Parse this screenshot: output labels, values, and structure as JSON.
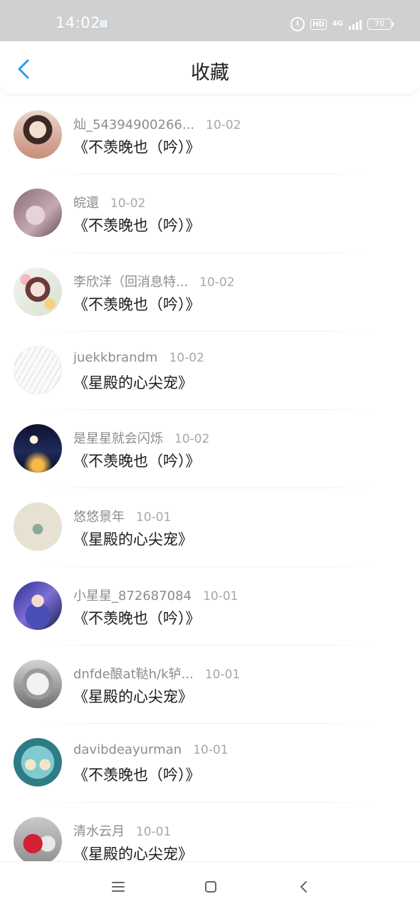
{
  "status_bar": {
    "time": "14:02",
    "hd_label": "HD",
    "network": "4G",
    "battery": "70"
  },
  "header": {
    "title": "收藏",
    "back_icon": "chevron-left-icon",
    "accent_color": "#2b9be8"
  },
  "favorites": [
    {
      "nickname": "灿_54394900266...",
      "date": "10-02",
      "work": "《不羡晚也（吟）》",
      "avatar": "avatar-girl-portrait"
    },
    {
      "nickname": "皖還",
      "date": "10-02",
      "work": "《不羡晚也（吟）》",
      "avatar": "avatar-anime-mauve"
    },
    {
      "nickname": "李欣洋（回消息特...",
      "date": "10-02",
      "work": "《不羡晚也（吟）》",
      "avatar": "avatar-anime-flowers"
    },
    {
      "nickname": "juekkbrandm",
      "date": "10-02",
      "work": "《星殿的心尖宠》",
      "avatar": "avatar-sketch"
    },
    {
      "nickname": "是星星就会闪烁",
      "date": "10-02",
      "work": "《不羡晚也（吟）》",
      "avatar": "avatar-night-moon"
    },
    {
      "nickname": "悠悠景年",
      "date": "10-01",
      "work": "《星殿的心尖宠》",
      "avatar": "avatar-beige-illustration"
    },
    {
      "nickname": "小星星_872687084",
      "date": "10-01",
      "work": "《不羡晚也（吟）》",
      "avatar": "avatar-anime-starry"
    },
    {
      "nickname": "dnfde酿at鞑h/k轳...",
      "date": "10-01",
      "work": "《星殿的心尖宠》",
      "avatar": "avatar-mime-face"
    },
    {
      "nickname": "davibdeayurman",
      "date": "10-01",
      "work": "《不羡晚也（吟）》",
      "avatar": "avatar-owls"
    },
    {
      "nickname": "清水云月",
      "date": "10-01",
      "work": "《星殿的心尖宠》",
      "avatar": "avatar-red-flower"
    }
  ],
  "nav": {
    "menu_icon": "menu-icon",
    "home_icon": "home-square-icon",
    "back_icon": "back-triangle-icon"
  }
}
